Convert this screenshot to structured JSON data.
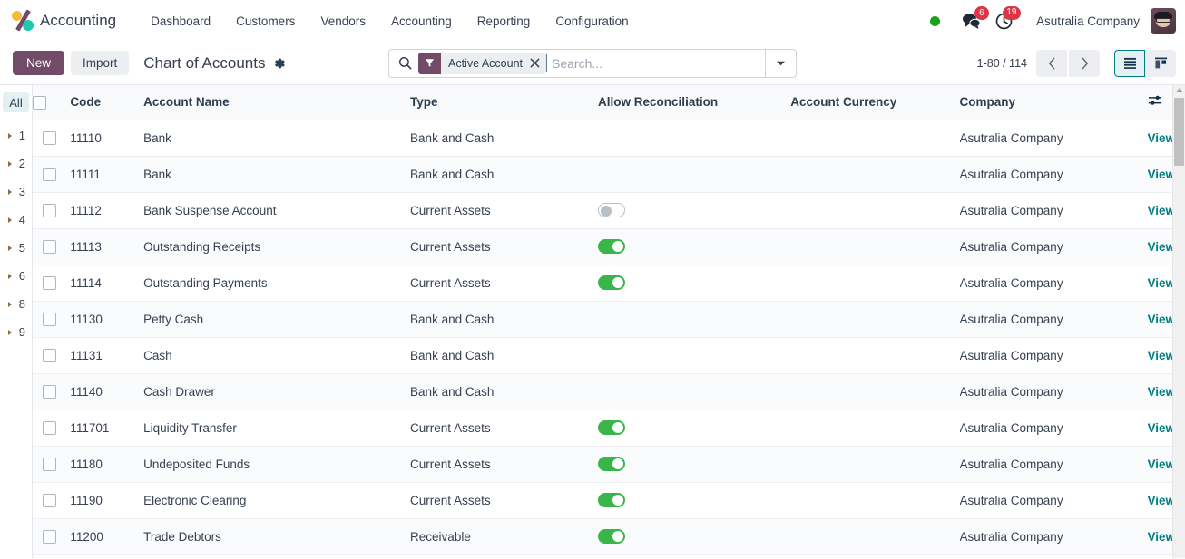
{
  "navbar": {
    "brand": "Accounting",
    "logo_icon": "odoo-logo-icon",
    "menu_items": [
      {
        "label": "Dashboard"
      },
      {
        "label": "Customers"
      },
      {
        "label": "Vendors"
      },
      {
        "label": "Accounting"
      },
      {
        "label": "Reporting"
      },
      {
        "label": "Configuration"
      }
    ],
    "status_dot_color": "#19a319",
    "messages_icon": "messages-icon",
    "messages_badge": "6",
    "activities_icon": "clock-icon",
    "activities_badge": "19",
    "company": "Asutralia Company",
    "avatar_icon": "user-avatar"
  },
  "control_panel": {
    "new_label": "New",
    "import_label": "Import",
    "breadcrumb_title": "Chart of Accounts",
    "settings_icon": "gear-icon",
    "search": {
      "search_icon": "search-icon",
      "facet_icon": "filter-icon",
      "facet_label": "Active Account",
      "facet_remove_icon": "close-icon",
      "placeholder": "Search...",
      "value": "",
      "dropdown_icon": "chevron-down-icon"
    },
    "pager": {
      "range": "1-80 / 114",
      "prev_icon": "chevron-left-icon",
      "next_icon": "chevron-right-icon"
    },
    "view_switcher": {
      "list_icon": "list-view-icon",
      "kanban_icon": "kanban-view-icon",
      "active": "list",
      "active_color": "#017e84"
    }
  },
  "sidebar": {
    "items": [
      {
        "label": "All",
        "active": true,
        "expandable": false
      },
      {
        "label": "1",
        "active": false,
        "expandable": true
      },
      {
        "label": "2",
        "active": false,
        "expandable": true
      },
      {
        "label": "3",
        "active": false,
        "expandable": true
      },
      {
        "label": "4",
        "active": false,
        "expandable": true
      },
      {
        "label": "5",
        "active": false,
        "expandable": true
      },
      {
        "label": "6",
        "active": false,
        "expandable": true
      },
      {
        "label": "8",
        "active": false,
        "expandable": true
      },
      {
        "label": "9",
        "active": false,
        "expandable": true
      }
    ]
  },
  "table": {
    "columns": [
      "Code",
      "Account Name",
      "Type",
      "Allow Reconciliation",
      "Account Currency",
      "Company"
    ],
    "optional_columns_icon": "column-settings-icon",
    "view_label": "View",
    "rows": [
      {
        "code": "11110",
        "name": "Bank",
        "type": "Bank and Cash",
        "reconcile": null,
        "currency": "",
        "company": "Asutralia Company"
      },
      {
        "code": "11111",
        "name": "Bank",
        "type": "Bank and Cash",
        "reconcile": null,
        "currency": "",
        "company": "Asutralia Company"
      },
      {
        "code": "11112",
        "name": "Bank Suspense Account",
        "type": "Current Assets",
        "reconcile": false,
        "currency": "",
        "company": "Asutralia Company"
      },
      {
        "code": "11113",
        "name": "Outstanding Receipts",
        "type": "Current Assets",
        "reconcile": true,
        "currency": "",
        "company": "Asutralia Company"
      },
      {
        "code": "11114",
        "name": "Outstanding Payments",
        "type": "Current Assets",
        "reconcile": true,
        "currency": "",
        "company": "Asutralia Company"
      },
      {
        "code": "11130",
        "name": "Petty Cash",
        "type": "Bank and Cash",
        "reconcile": null,
        "currency": "",
        "company": "Asutralia Company"
      },
      {
        "code": "11131",
        "name": "Cash",
        "type": "Bank and Cash",
        "reconcile": null,
        "currency": "",
        "company": "Asutralia Company"
      },
      {
        "code": "11140",
        "name": "Cash Drawer",
        "type": "Bank and Cash",
        "reconcile": null,
        "currency": "",
        "company": "Asutralia Company"
      },
      {
        "code": "111701",
        "name": "Liquidity Transfer",
        "type": "Current Assets",
        "reconcile": true,
        "currency": "",
        "company": "Asutralia Company"
      },
      {
        "code": "11180",
        "name": "Undeposited Funds",
        "type": "Current Assets",
        "reconcile": true,
        "currency": "",
        "company": "Asutralia Company"
      },
      {
        "code": "11190",
        "name": "Electronic Clearing",
        "type": "Current Assets",
        "reconcile": true,
        "currency": "",
        "company": "Asutralia Company"
      },
      {
        "code": "11200",
        "name": "Trade Debtors",
        "type": "Receivable",
        "reconcile": true,
        "currency": "",
        "company": "Asutralia Company"
      }
    ]
  }
}
